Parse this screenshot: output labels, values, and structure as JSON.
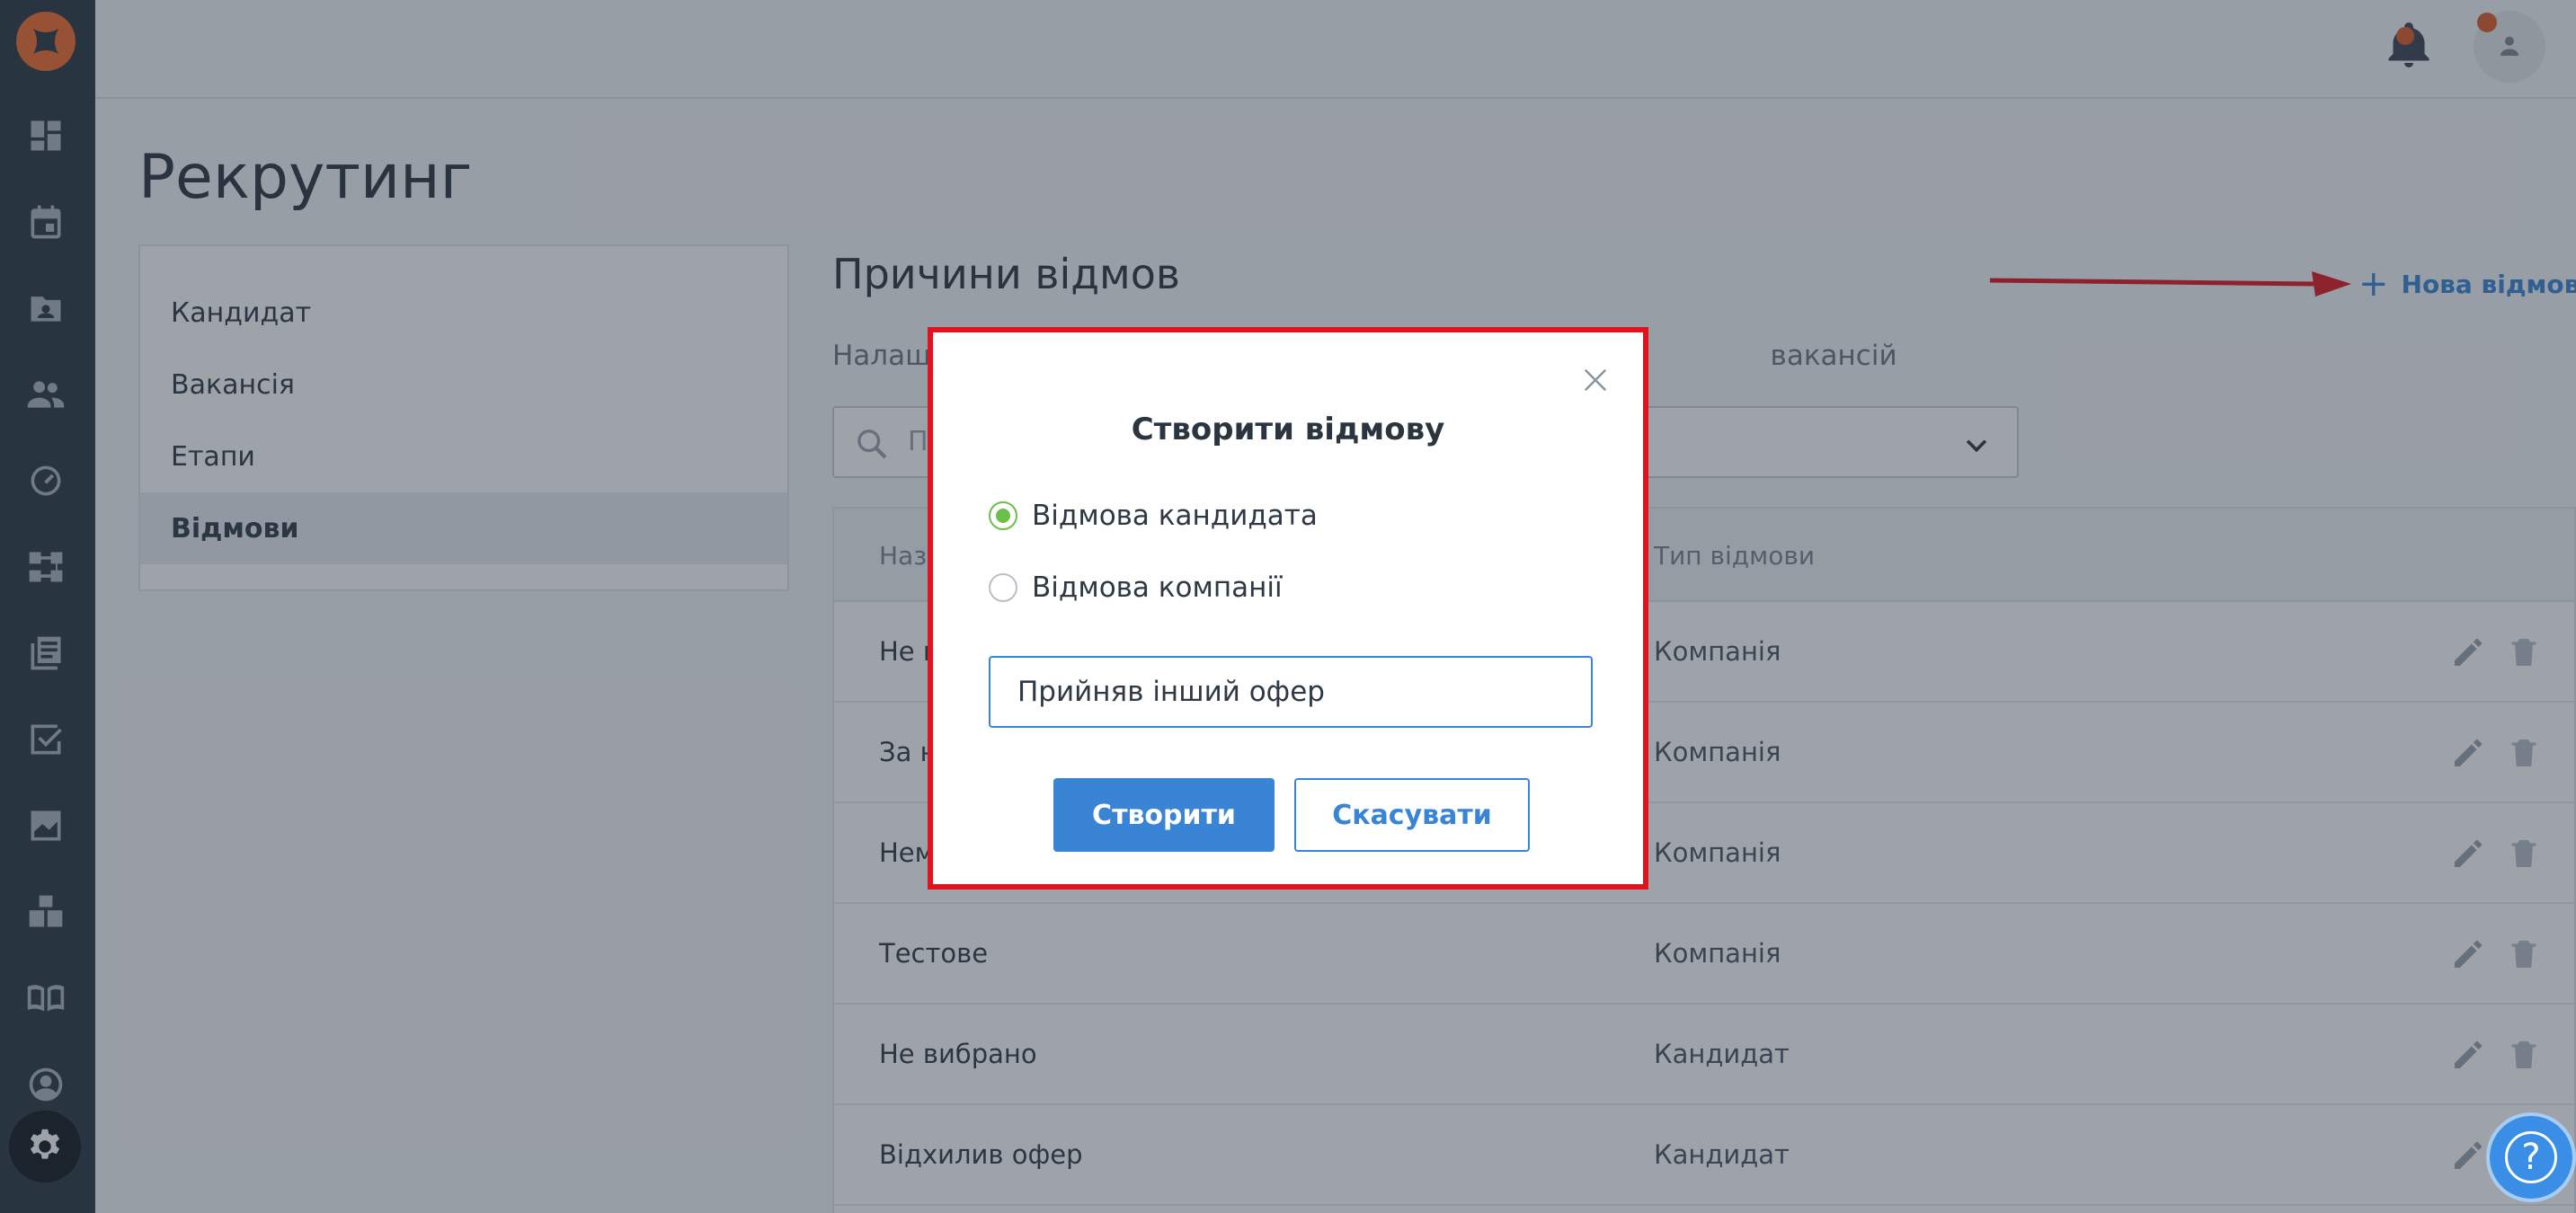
{
  "nav": {
    "items": [
      "dashboard-icon",
      "calendar-icon",
      "contacts-folder-icon",
      "people-icon",
      "speedometer-icon",
      "workflow-icon",
      "documents-icon",
      "checklist-icon",
      "analytics-icon",
      "boxes-icon",
      "book-icon",
      "user-circle-icon"
    ],
    "active": "gear-icon"
  },
  "page": {
    "title": "Рекрутинг"
  },
  "settings_menu": [
    "Кандидат",
    "Вакансія",
    "Етапи",
    "Відмови"
  ],
  "section": {
    "title": "Причини відмов",
    "subtitle_left": "Налашт",
    "subtitle_right": "вакансій",
    "add_label": "Нова відмова",
    "add_icon": "+"
  },
  "search": {
    "placeholder": "П"
  },
  "table": {
    "columns": [
      "Назв",
      "Тип відмови"
    ],
    "rows": [
      {
        "name": "Не в",
        "type": "Компанія"
      },
      {
        "name": "За н",
        "type": "Компанія"
      },
      {
        "name": "Нем",
        "type": "Компанія"
      },
      {
        "name": "Тестове",
        "type": "Компанія"
      },
      {
        "name": "Не вибрано",
        "type": "Кандидат"
      },
      {
        "name": "Відхилив офер",
        "type": "Кандидат"
      }
    ]
  },
  "modal": {
    "title": "Створити відмову",
    "options": [
      {
        "label": "Відмова кандидата",
        "checked": true
      },
      {
        "label": "Відмова компанії",
        "checked": false
      }
    ],
    "input_value": "Прийняв інший офер",
    "create_label": "Створити",
    "cancel_label": "Скасувати",
    "highlight_color": "#e0141e"
  },
  "help": {
    "label": "?"
  },
  "colors": {
    "accent": "#3a84d6",
    "brand": "#f36b2a",
    "radio_checked": "#6cc04a",
    "sidebar": "#2a3542"
  }
}
